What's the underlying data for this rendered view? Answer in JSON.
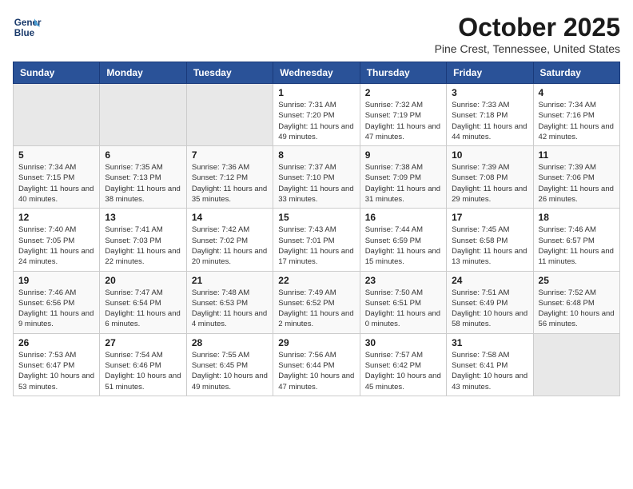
{
  "header": {
    "logo_line1": "General",
    "logo_line2": "Blue",
    "month_title": "October 2025",
    "location": "Pine Crest, Tennessee, United States"
  },
  "weekdays": [
    "Sunday",
    "Monday",
    "Tuesday",
    "Wednesday",
    "Thursday",
    "Friday",
    "Saturday"
  ],
  "weeks": [
    [
      {
        "day": "",
        "sunrise": "",
        "sunset": "",
        "daylight": ""
      },
      {
        "day": "",
        "sunrise": "",
        "sunset": "",
        "daylight": ""
      },
      {
        "day": "",
        "sunrise": "",
        "sunset": "",
        "daylight": ""
      },
      {
        "day": "1",
        "sunrise": "Sunrise: 7:31 AM",
        "sunset": "Sunset: 7:20 PM",
        "daylight": "Daylight: 11 hours and 49 minutes."
      },
      {
        "day": "2",
        "sunrise": "Sunrise: 7:32 AM",
        "sunset": "Sunset: 7:19 PM",
        "daylight": "Daylight: 11 hours and 47 minutes."
      },
      {
        "day": "3",
        "sunrise": "Sunrise: 7:33 AM",
        "sunset": "Sunset: 7:18 PM",
        "daylight": "Daylight: 11 hours and 44 minutes."
      },
      {
        "day": "4",
        "sunrise": "Sunrise: 7:34 AM",
        "sunset": "Sunset: 7:16 PM",
        "daylight": "Daylight: 11 hours and 42 minutes."
      }
    ],
    [
      {
        "day": "5",
        "sunrise": "Sunrise: 7:34 AM",
        "sunset": "Sunset: 7:15 PM",
        "daylight": "Daylight: 11 hours and 40 minutes."
      },
      {
        "day": "6",
        "sunrise": "Sunrise: 7:35 AM",
        "sunset": "Sunset: 7:13 PM",
        "daylight": "Daylight: 11 hours and 38 minutes."
      },
      {
        "day": "7",
        "sunrise": "Sunrise: 7:36 AM",
        "sunset": "Sunset: 7:12 PM",
        "daylight": "Daylight: 11 hours and 35 minutes."
      },
      {
        "day": "8",
        "sunrise": "Sunrise: 7:37 AM",
        "sunset": "Sunset: 7:10 PM",
        "daylight": "Daylight: 11 hours and 33 minutes."
      },
      {
        "day": "9",
        "sunrise": "Sunrise: 7:38 AM",
        "sunset": "Sunset: 7:09 PM",
        "daylight": "Daylight: 11 hours and 31 minutes."
      },
      {
        "day": "10",
        "sunrise": "Sunrise: 7:39 AM",
        "sunset": "Sunset: 7:08 PM",
        "daylight": "Daylight: 11 hours and 29 minutes."
      },
      {
        "day": "11",
        "sunrise": "Sunrise: 7:39 AM",
        "sunset": "Sunset: 7:06 PM",
        "daylight": "Daylight: 11 hours and 26 minutes."
      }
    ],
    [
      {
        "day": "12",
        "sunrise": "Sunrise: 7:40 AM",
        "sunset": "Sunset: 7:05 PM",
        "daylight": "Daylight: 11 hours and 24 minutes."
      },
      {
        "day": "13",
        "sunrise": "Sunrise: 7:41 AM",
        "sunset": "Sunset: 7:03 PM",
        "daylight": "Daylight: 11 hours and 22 minutes."
      },
      {
        "day": "14",
        "sunrise": "Sunrise: 7:42 AM",
        "sunset": "Sunset: 7:02 PM",
        "daylight": "Daylight: 11 hours and 20 minutes."
      },
      {
        "day": "15",
        "sunrise": "Sunrise: 7:43 AM",
        "sunset": "Sunset: 7:01 PM",
        "daylight": "Daylight: 11 hours and 17 minutes."
      },
      {
        "day": "16",
        "sunrise": "Sunrise: 7:44 AM",
        "sunset": "Sunset: 6:59 PM",
        "daylight": "Daylight: 11 hours and 15 minutes."
      },
      {
        "day": "17",
        "sunrise": "Sunrise: 7:45 AM",
        "sunset": "Sunset: 6:58 PM",
        "daylight": "Daylight: 11 hours and 13 minutes."
      },
      {
        "day": "18",
        "sunrise": "Sunrise: 7:46 AM",
        "sunset": "Sunset: 6:57 PM",
        "daylight": "Daylight: 11 hours and 11 minutes."
      }
    ],
    [
      {
        "day": "19",
        "sunrise": "Sunrise: 7:46 AM",
        "sunset": "Sunset: 6:56 PM",
        "daylight": "Daylight: 11 hours and 9 minutes."
      },
      {
        "day": "20",
        "sunrise": "Sunrise: 7:47 AM",
        "sunset": "Sunset: 6:54 PM",
        "daylight": "Daylight: 11 hours and 6 minutes."
      },
      {
        "day": "21",
        "sunrise": "Sunrise: 7:48 AM",
        "sunset": "Sunset: 6:53 PM",
        "daylight": "Daylight: 11 hours and 4 minutes."
      },
      {
        "day": "22",
        "sunrise": "Sunrise: 7:49 AM",
        "sunset": "Sunset: 6:52 PM",
        "daylight": "Daylight: 11 hours and 2 minutes."
      },
      {
        "day": "23",
        "sunrise": "Sunrise: 7:50 AM",
        "sunset": "Sunset: 6:51 PM",
        "daylight": "Daylight: 11 hours and 0 minutes."
      },
      {
        "day": "24",
        "sunrise": "Sunrise: 7:51 AM",
        "sunset": "Sunset: 6:49 PM",
        "daylight": "Daylight: 10 hours and 58 minutes."
      },
      {
        "day": "25",
        "sunrise": "Sunrise: 7:52 AM",
        "sunset": "Sunset: 6:48 PM",
        "daylight": "Daylight: 10 hours and 56 minutes."
      }
    ],
    [
      {
        "day": "26",
        "sunrise": "Sunrise: 7:53 AM",
        "sunset": "Sunset: 6:47 PM",
        "daylight": "Daylight: 10 hours and 53 minutes."
      },
      {
        "day": "27",
        "sunrise": "Sunrise: 7:54 AM",
        "sunset": "Sunset: 6:46 PM",
        "daylight": "Daylight: 10 hours and 51 minutes."
      },
      {
        "day": "28",
        "sunrise": "Sunrise: 7:55 AM",
        "sunset": "Sunset: 6:45 PM",
        "daylight": "Daylight: 10 hours and 49 minutes."
      },
      {
        "day": "29",
        "sunrise": "Sunrise: 7:56 AM",
        "sunset": "Sunset: 6:44 PM",
        "daylight": "Daylight: 10 hours and 47 minutes."
      },
      {
        "day": "30",
        "sunrise": "Sunrise: 7:57 AM",
        "sunset": "Sunset: 6:42 PM",
        "daylight": "Daylight: 10 hours and 45 minutes."
      },
      {
        "day": "31",
        "sunrise": "Sunrise: 7:58 AM",
        "sunset": "Sunset: 6:41 PM",
        "daylight": "Daylight: 10 hours and 43 minutes."
      },
      {
        "day": "",
        "sunrise": "",
        "sunset": "",
        "daylight": ""
      }
    ]
  ]
}
